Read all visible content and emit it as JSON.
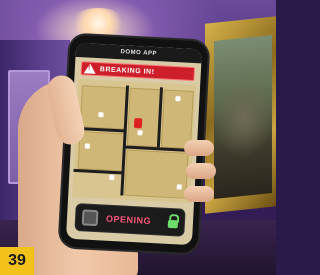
{
  "phone": {
    "app_title": "DOMO APP",
    "alert_label": "BREAKING IN!",
    "door_status": "OPENING"
  },
  "badge": {
    "number": "39"
  },
  "colors": {
    "alert": "#cc1f2a",
    "door_status": "#ff5577",
    "lock": "#6ddc6d",
    "badge": "#f2c21b"
  },
  "icons": [
    "warning-icon",
    "padlock-icon",
    "door-toggle-icon",
    "player-marker-icon"
  ]
}
